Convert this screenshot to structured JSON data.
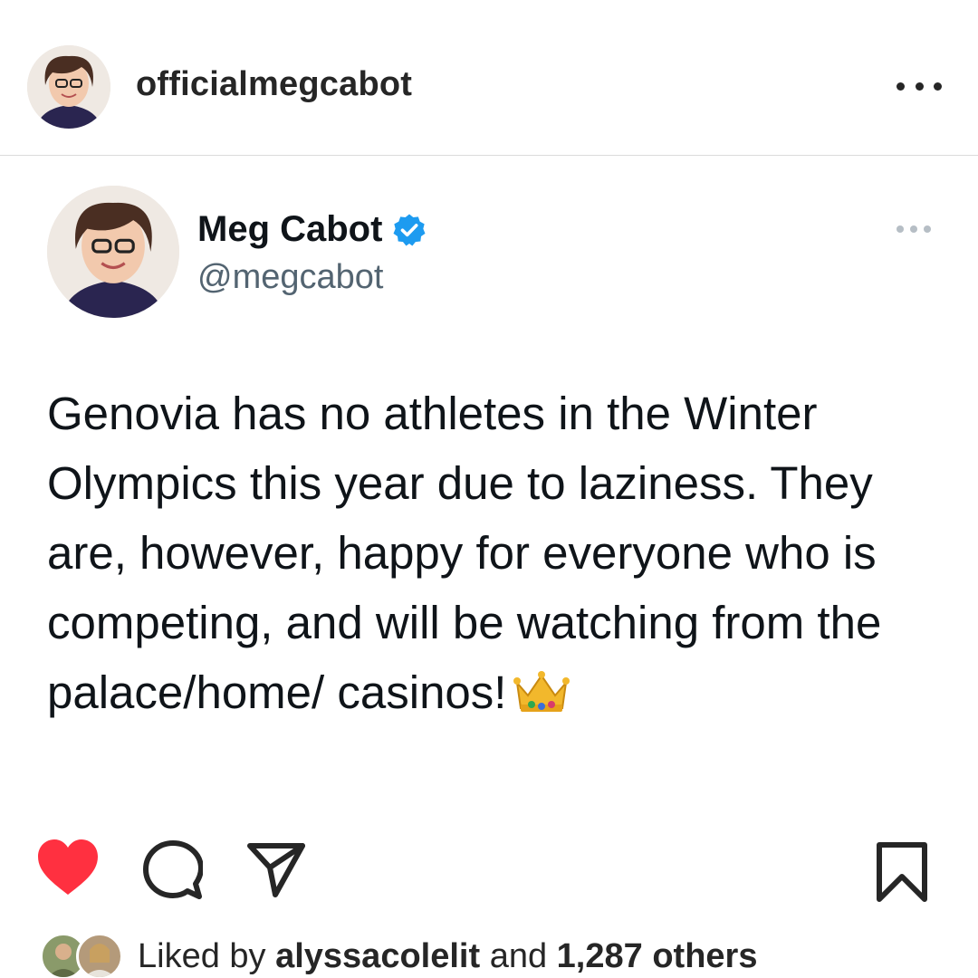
{
  "header": {
    "username": "officialmegcabot"
  },
  "tweet": {
    "display_name": "Meg Cabot",
    "handle": "@megcabot",
    "text": "Genovia has no athletes in the Winter Olympics this year due to laziness. They are, however, happy for everyone who is competing, and will be watching from the palace/home/ casinos!",
    "emoji": "crown-icon"
  },
  "likes": {
    "prefix": "Liked by ",
    "user": "alyssacolelit",
    "middle": " and ",
    "count": "1,287 others"
  },
  "colors": {
    "heart": "#ff3040",
    "verified": "#1d9bf0",
    "text": "#0f1419",
    "handle": "#536471"
  },
  "icons": {
    "like": "heart-icon",
    "comment": "comment-icon",
    "share": "share-icon",
    "save": "bookmark-icon",
    "more": "more-icon"
  }
}
